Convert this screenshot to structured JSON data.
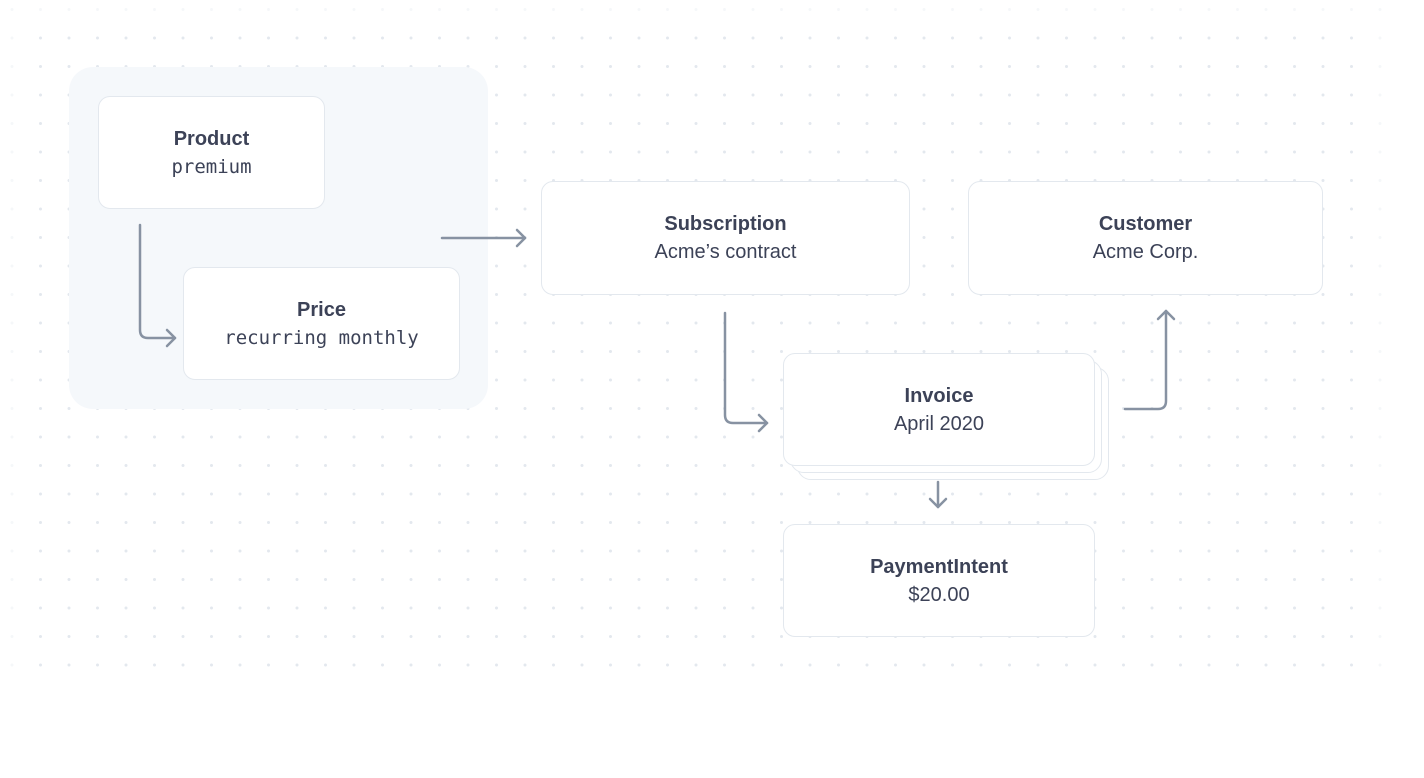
{
  "diagram": {
    "nodes": {
      "product": {
        "title": "Product",
        "subtitle": "premium"
      },
      "price": {
        "title": "Price",
        "subtitle": "recurring monthly"
      },
      "subscription": {
        "title": "Subscription",
        "subtitle": "Acme’s contract"
      },
      "customer": {
        "title": "Customer",
        "subtitle": "Acme Corp."
      },
      "invoice": {
        "title": "Invoice",
        "subtitle": "April 2020"
      },
      "payment_intent": {
        "title": "PaymentIntent",
        "subtitle": "$20.00"
      }
    },
    "edges": [
      {
        "from": "product",
        "to": "price"
      },
      {
        "from": "product-price-group",
        "to": "subscription"
      },
      {
        "from": "subscription",
        "to": "invoice"
      },
      {
        "from": "invoice",
        "to": "customer"
      },
      {
        "from": "invoice",
        "to": "payment_intent"
      }
    ],
    "colors": {
      "text": "#3c4257",
      "border": "#e3e8ee",
      "arrow": "#8792a2",
      "group_background": "#f5f8fb",
      "dot": "#e3e8ee"
    }
  }
}
